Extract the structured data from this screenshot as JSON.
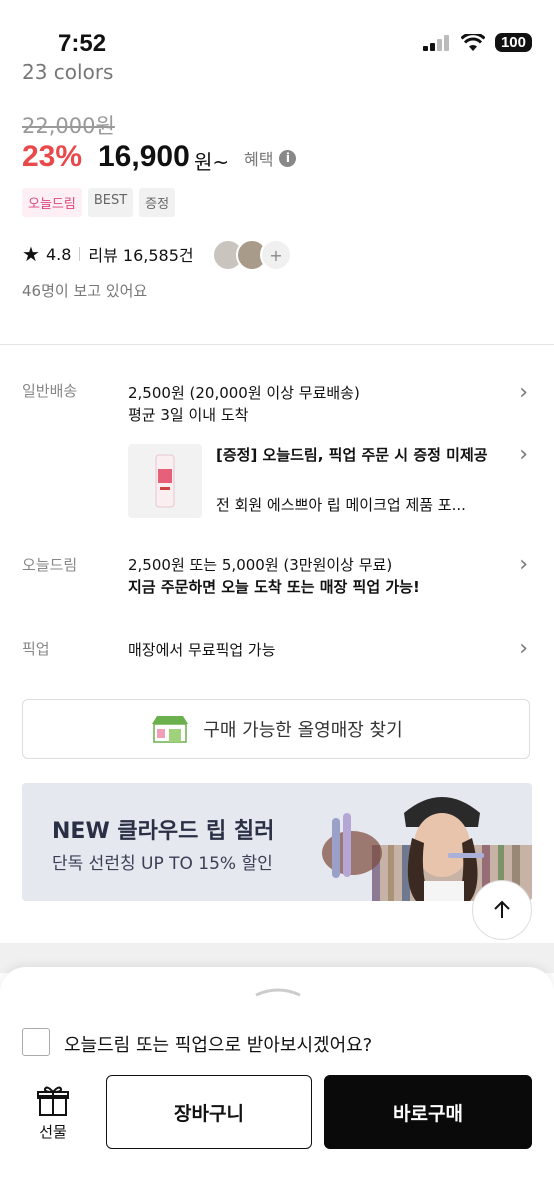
{
  "status_bar": {
    "time": "7:52",
    "battery": "100"
  },
  "product": {
    "colors_text": "23 colors",
    "original_price": "22,000원",
    "discount": "23%",
    "price": "16,900",
    "price_suffix": "원~",
    "benefit_label": "혜택",
    "tags": [
      "오늘드림",
      "BEST",
      "증정"
    ],
    "rating": "4.8",
    "review_label": "리뷰 16,585건",
    "viewers": "46명이 보고 있어요"
  },
  "shipping": {
    "label": "일반배송",
    "line1": "2,500원 (20,000원 이상 무료배송)",
    "line2": "평균 3일 이내 도착"
  },
  "gift": {
    "title": "[증정] 오늘드림, 픽업 주문 시 증정 미제공",
    "desc": "전 회원 에스쁘아 립 메이크업 제품 포..."
  },
  "today_dream": {
    "label": "오늘드림",
    "line1": "2,500원 또는 5,000원 (3만원이상 무료)",
    "line2": "지금 주문하면 오늘 도착 또는 매장 픽업 가능!"
  },
  "pickup": {
    "label": "픽업",
    "line1": "매장에서 무료픽업 가능"
  },
  "store_button": "구매 가능한 올영매장 찾기",
  "banner": {
    "title": "NEW 클라우드 립 칠러",
    "subtitle": "단독 선런칭 UP TO 15% 할인"
  },
  "bottom_sheet": {
    "checkbox_label": "오늘드림 또는 픽업으로 받아보시겠어요?",
    "gift_label": "선물",
    "cart_label": "장바구니",
    "buy_label": "바로구매"
  },
  "colors": {
    "discount": "#e8494b",
    "tag_pink": "#e0467c",
    "buy_button": "#0a0a0a"
  }
}
